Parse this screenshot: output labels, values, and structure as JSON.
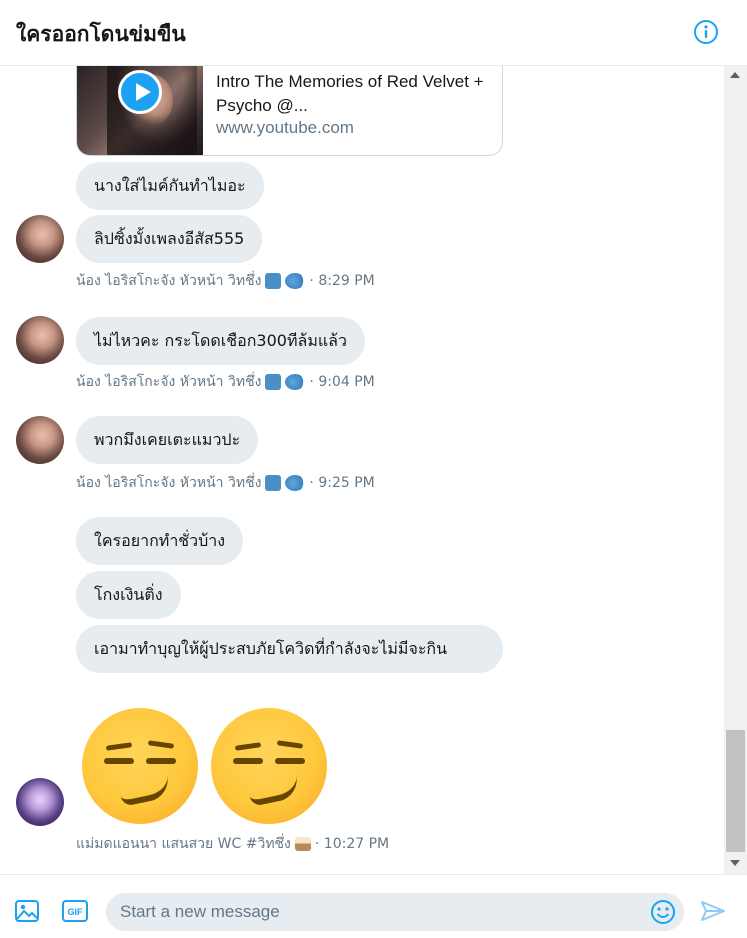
{
  "header": {
    "title": "ใครออกโดนข่มขืน",
    "info_icon": "info-icon"
  },
  "link_card": {
    "title": "Intro The Memories of Red Velvet + Psycho @...",
    "url": "www.youtube.com",
    "play_icon": "play-icon"
  },
  "messages": [
    {
      "text": "นางใส่ไมค์กันทำไมอะ"
    },
    {
      "text": "ลิปซิ้งมั้งเพลงอีสัส555"
    },
    {
      "text": "ไม่ไหวคะ กระโดดเชือก300ทีล้มแล้ว"
    },
    {
      "text": "พวกมึงเคยเตะแมวปะ"
    },
    {
      "text": "ใครอยากทำชั่วบ้าง"
    },
    {
      "text": "โกงเงินติ่ง"
    },
    {
      "text": "เอามาทำบุญให้ผู้ประสบภัยโควิดที่กำลังจะไม่มีจะกิน"
    }
  ],
  "meta": [
    {
      "name": "น้อง ไอริสโกะจัง หัวหน้า วิทชึ่ง",
      "time": "· 8:29 PM"
    },
    {
      "name": "น้อง ไอริสโกะจัง หัวหน้า วิทชึ่ง",
      "time": "· 9:04 PM"
    },
    {
      "name": "น้อง ไอริสโกะจัง หัวหน้า วิทชึ่ง",
      "time": "· 9:25 PM"
    },
    {
      "name": "แม่มดแอนนา แสนสวย WC #วิทชึ่ง",
      "time": "· 10:27 PM"
    }
  ],
  "emoji_message": {
    "icons": [
      "smirking-face-icon",
      "smirking-face-icon"
    ]
  },
  "composer": {
    "placeholder": "Start a new message",
    "value": "",
    "gif_label": "GIF"
  },
  "colors": {
    "accent": "#1da1f2",
    "bubble": "#e6ecf0",
    "meta_text": "#657786"
  }
}
